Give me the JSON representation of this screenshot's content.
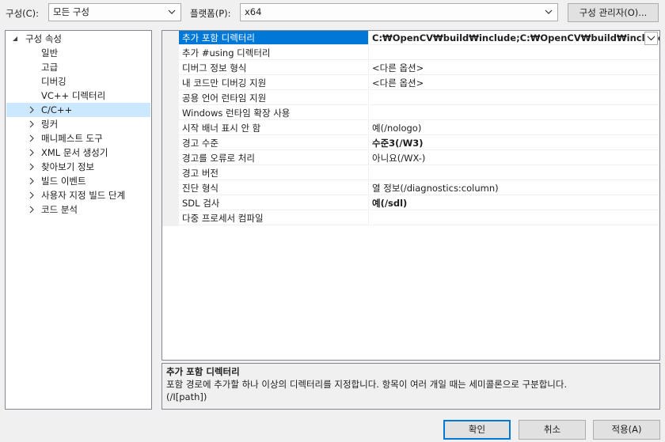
{
  "toolbar": {
    "config_label": "구성(C):",
    "config_value": "모든 구성",
    "platform_label": "플랫폼(P):",
    "platform_value": "x64",
    "config_manager_button": "구성 관리자(O)..."
  },
  "tree": {
    "root": "구성 속성",
    "items": [
      {
        "label": "일반",
        "expandable": false
      },
      {
        "label": "고급",
        "expandable": false
      },
      {
        "label": "디버깅",
        "expandable": false
      },
      {
        "label": "VC++ 디렉터리",
        "expandable": false
      },
      {
        "label": "C/C++",
        "expandable": true,
        "selected": true
      },
      {
        "label": "링커",
        "expandable": true
      },
      {
        "label": "매니페스트 도구",
        "expandable": true
      },
      {
        "label": "XML 문서 생성기",
        "expandable": true
      },
      {
        "label": "찾아보기 정보",
        "expandable": true
      },
      {
        "label": "빌드 이벤트",
        "expandable": true
      },
      {
        "label": "사용자 지정 빌드 단계",
        "expandable": true
      },
      {
        "label": "코드 분석",
        "expandable": true
      }
    ]
  },
  "properties": [
    {
      "name": "추가 포함 디렉터리",
      "value": "C:₩OpenCV₩build₩include;C:₩OpenCV₩build₩include₩ope",
      "bold": true,
      "selected": true
    },
    {
      "name": "추가 #using 디렉터리",
      "value": ""
    },
    {
      "name": "디버그 정보 형식",
      "value": "<다른 옵션>"
    },
    {
      "name": "내 코드만 디버깅 지원",
      "value": "<다른 옵션>"
    },
    {
      "name": "공용 언어 런타임 지원",
      "value": ""
    },
    {
      "name": "Windows 런타임 확장 사용",
      "value": ""
    },
    {
      "name": "시작 배너 표시 안 함",
      "value": "예(/nologo)"
    },
    {
      "name": "경고 수준",
      "value": "수준3(/W3)",
      "bold": true
    },
    {
      "name": "경고를 오류로 처리",
      "value": "아니요(/WX-)"
    },
    {
      "name": "경고 버전",
      "value": ""
    },
    {
      "name": "진단 형식",
      "value": "열 정보(/diagnostics:column)"
    },
    {
      "name": "SDL 검사",
      "value": "예(/sdl)",
      "bold": true
    },
    {
      "name": "다중 프로세서 컴파일",
      "value": ""
    }
  ],
  "description": {
    "title": "추가 포함 디렉터리",
    "text": "포함 경로에 추가할 하나 이상의 디렉터리를 지정합니다. 항목이 여러 개일 때는 세미콜론으로 구분합니다.",
    "switch": "(/I[path])"
  },
  "buttons": {
    "ok": "확인",
    "cancel": "취소",
    "apply": "적용(A)"
  },
  "colors": {
    "selection": "#0078d7",
    "tree_selection": "#cce8ff",
    "dialog_bg": "#f0f0f0"
  }
}
